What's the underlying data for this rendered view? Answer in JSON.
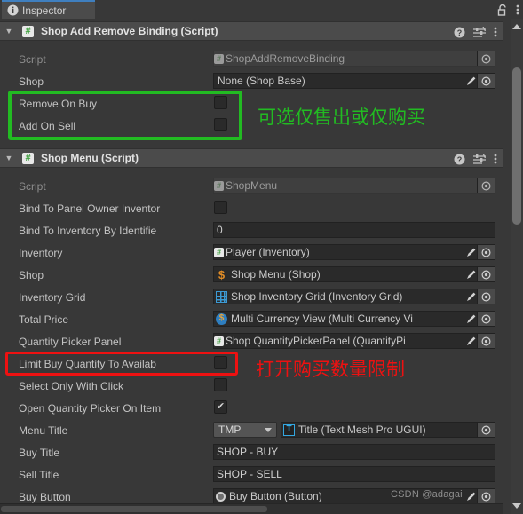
{
  "window": {
    "tab_label": "Inspector",
    "tab_icon": "info-icon",
    "lock_icon": "unlocked-padlock-icon",
    "menu_icon": "kebab-menu-icon"
  },
  "components": [
    {
      "title": "Shop Add Remove Binding (Script)",
      "icon": "cs-script-icon",
      "help_icon": "help-icon",
      "preset_icon": "preset-selector-icon",
      "menu_icon": "kebab-menu-icon",
      "rows": [
        {
          "type": "object_dim",
          "label": "Script",
          "badge": "cs-script-icon",
          "value": "ShopAddRemoveBinding",
          "pick": true,
          "pen": false
        },
        {
          "type": "object",
          "label": "Shop",
          "badge": "none",
          "value": "None (Shop Base)",
          "pick": true,
          "pen": true
        },
        {
          "type": "checkbox",
          "label": "Remove On Buy",
          "checked": false
        },
        {
          "type": "checkbox",
          "label": "Add On Sell",
          "checked": false
        }
      ]
    },
    {
      "title": "Shop Menu (Script)",
      "icon": "cs-script-icon",
      "help_icon": "help-icon",
      "preset_icon": "preset-selector-icon",
      "menu_icon": "kebab-menu-icon",
      "rows": [
        {
          "type": "object_dim",
          "label": "Script",
          "badge": "cs-script-icon",
          "value": "ShopMenu",
          "pick": true,
          "pen": false
        },
        {
          "type": "checkbox",
          "label": "Bind To Panel Owner Inventor",
          "checked": false
        },
        {
          "type": "text",
          "label": "Bind To Inventory By Identifie",
          "value": "0"
        },
        {
          "type": "object",
          "label": "Inventory",
          "badge": "cs-script-icon",
          "value": "Player (Inventory)",
          "pick": true,
          "pen": true
        },
        {
          "type": "object",
          "label": "Shop",
          "badge": "dollar-icon",
          "value": "Shop Menu (Shop)",
          "pick": true,
          "pen": true
        },
        {
          "type": "object",
          "label": "Inventory Grid",
          "badge": "grid-icon",
          "value": "Shop Inventory Grid (Inventory Grid)",
          "pick": true,
          "pen": true
        },
        {
          "type": "object",
          "label": "Total Price",
          "badge": "coin-icon",
          "value": "Multi Currency View (Multi Currency Vi",
          "pick": true,
          "pen": true
        },
        {
          "type": "object",
          "label": "Quantity Picker Panel",
          "badge": "cs-script-icon",
          "value": "Shop QuantityPickerPanel (QuantityPi",
          "pick": true,
          "pen": true
        },
        {
          "type": "checkbox",
          "label": "Limit Buy Quantity To Availab",
          "checked": false
        },
        {
          "type": "checkbox",
          "label": "Select Only With Click",
          "checked": false
        },
        {
          "type": "checkbox",
          "label": "Open Quantity Picker On Item",
          "checked": true
        },
        {
          "type": "enum_object",
          "label": "Menu Title",
          "enum_value": "TMP",
          "badge": "tmp-text-icon",
          "value": "Title (Text Mesh Pro UGUI)",
          "pick": true,
          "pen": false
        },
        {
          "type": "text",
          "label": "Buy Title",
          "value": "SHOP - BUY"
        },
        {
          "type": "text",
          "label": "Sell Title",
          "value": "SHOP - SELL"
        },
        {
          "type": "object",
          "label": "Buy Button",
          "badge": "radio-button-icon",
          "value": "Buy Button (Button)",
          "pick": true,
          "pen": true
        }
      ]
    }
  ],
  "annotations": [
    {
      "id": "green-box",
      "kind": "box",
      "color": "#22bb22"
    },
    {
      "id": "green-note",
      "kind": "text",
      "color": "#22bb22",
      "text": "可选仅售出或仅购买"
    },
    {
      "id": "red-box",
      "kind": "box",
      "color": "#ee1111"
    },
    {
      "id": "red-note",
      "kind": "text",
      "color": "#ee1111",
      "text": "打开购买数量限制"
    }
  ],
  "watermark": {
    "text": "CSDN @adagai"
  },
  "scrollbars": {
    "vertical_up_icon": "triangle-up-icon",
    "vertical_down_icon": "triangle-down-icon"
  }
}
